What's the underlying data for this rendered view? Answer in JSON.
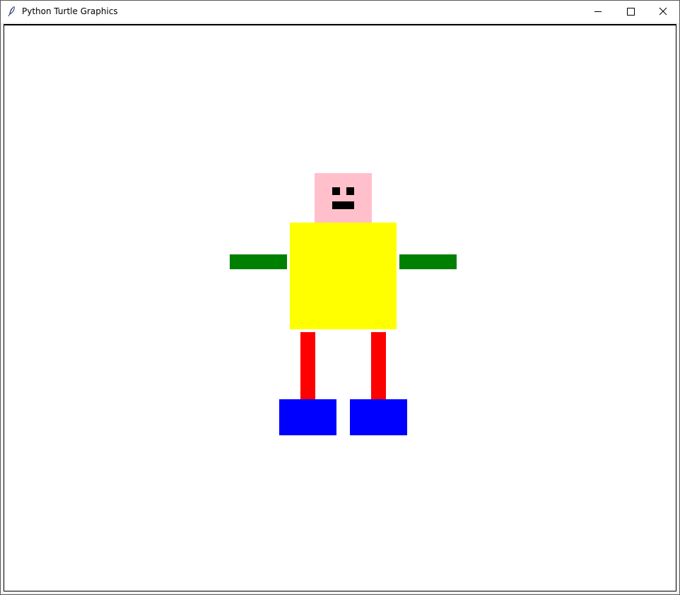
{
  "window": {
    "title": "Python Turtle Graphics",
    "title_icon": "feather-icon",
    "controls": {
      "minimize_icon": "minimize-icon",
      "maximize_icon": "maximize-icon",
      "close_icon": "close-icon"
    }
  },
  "drawing": {
    "background": "#ffffff",
    "colors": {
      "head": "#ffc0cb",
      "eyes": "#000000",
      "mouth": "#000000",
      "body": "#ffff00",
      "arms": "#008000",
      "legs": "#ff0000",
      "feet": "#0000ff"
    }
  }
}
